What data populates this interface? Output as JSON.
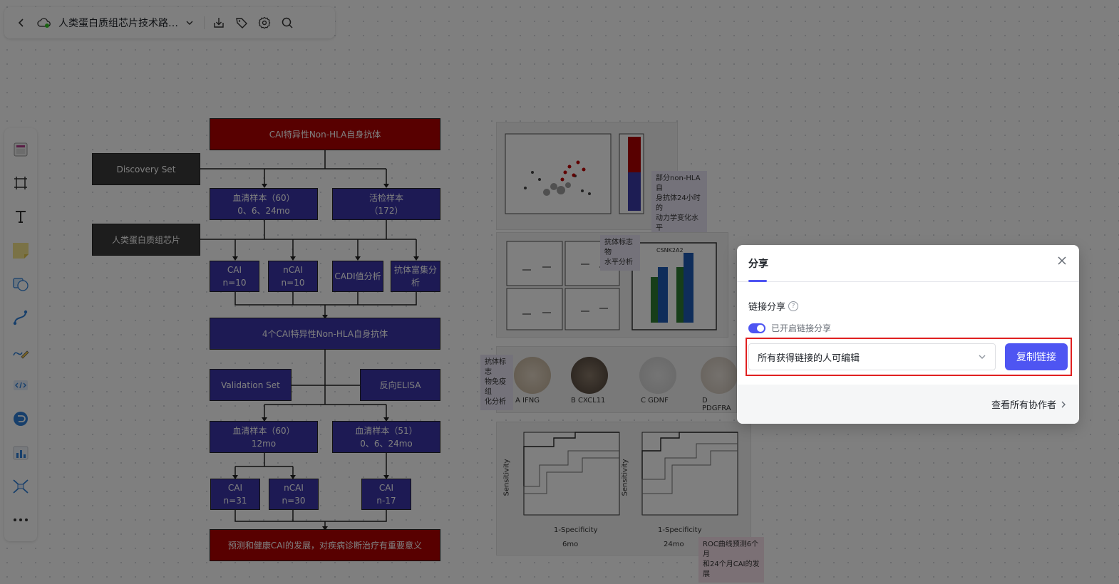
{
  "toolbar": {
    "back_icon": "chevron-left-icon",
    "cloud_icon": "cloud-synced-icon",
    "doc_title": "人类蛋白质组芯片技术路线图",
    "icons": [
      "download-icon",
      "tag-icon",
      "gear-icon",
      "search-icon"
    ]
  },
  "siderail": {
    "tools": [
      "frame-template-icon",
      "frame-icon",
      "text-icon",
      "sticky-note-icon",
      "shape-icon",
      "connector-icon",
      "pen-icon",
      "code-block-icon",
      "mindmap-icon",
      "chart-icon",
      "flow-icon",
      "more-icon"
    ]
  },
  "flowchart": {
    "title": "CAI特异性Non-HLA自身抗体",
    "discovery": "Discovery Set",
    "proteome": "人类蛋白质组芯片",
    "serum1_l1": "血清样本（60）",
    "serum1_l2": "0、6、24mo",
    "biopsy_l1": "活检样本",
    "biopsy_l2": "（172）",
    "cai1_l1": "CAI",
    "cai1_l2": "n=10",
    "ncai1_l1": "nCAI",
    "ncai1_l2": "n=10",
    "cadi": "CADI值分析",
    "enrich_l1": "抗体富集分",
    "enrich_l2": "析",
    "four_ab": "4个CAI特异性Non-HLA自身抗体",
    "validation": "Validation Set",
    "elisa": "反向ELISA",
    "serum2_l1": "血清样本（60）",
    "serum2_l2": "12mo",
    "serum3_l1": "血清样本（51）",
    "serum3_l2": "0、6、24mo",
    "cai2_l1": "CAI",
    "cai2_l2": "n=31",
    "ncai2_l1": "nCAI",
    "ncai2_l2": "n=30",
    "cai3_l1": "CAI",
    "cai3_l2": "n-17",
    "conclusion": "预测和健康CAI的发展，对疾病诊断治疗有重要意义"
  },
  "figures": {
    "note1_l1": "部分non-HLA自",
    "note1_l2": "身抗体24小时的",
    "note1_l3": "动力学变化水平",
    "note2_l1": "抗体标志物",
    "note2_l2": "水平分析",
    "note3_l1": "抗体标志",
    "note3_l2": "物免疫组",
    "note3_l3": "化分析",
    "note4_l1": "ROC曲线预测6个月",
    "note4_l2": "和24个月CAI的发展",
    "ihc_labels": [
      "A  IFNG",
      "B  CXCL11",
      "C  GDNF",
      "D  PDGFRA"
    ],
    "roc_x": "1-Specificity",
    "roc_y": "Sensitivity",
    "roc_left": "6mo",
    "roc_right": "24mo",
    "bar_title": "CSNK2A2"
  },
  "dialog": {
    "tab": "分享",
    "close_icon": "close-icon",
    "section_title": "链接分享",
    "help_icon": "?",
    "toggle_label": "已开启链接分享",
    "toggle_on": true,
    "permission": "所有获得链接的人可编辑",
    "copy_button": "复制链接",
    "view_collaborators": "查看所有协作者",
    "accent": "#4e55f2"
  }
}
